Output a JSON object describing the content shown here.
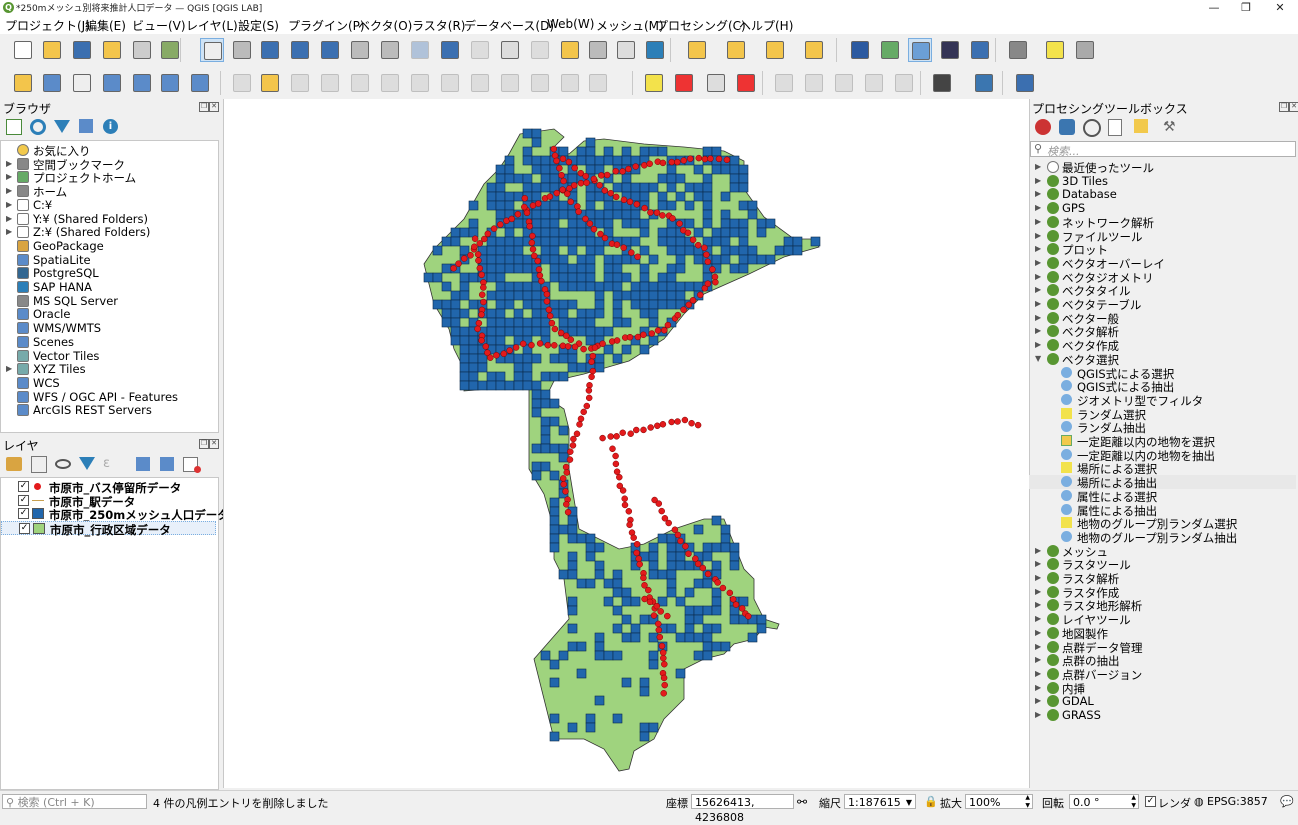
{
  "window": {
    "title": "*250mメッシュ別将来推計人口データ — QGIS [QGIS LAB]",
    "logo": "Q",
    "controls": [
      "—",
      "❐",
      "✕"
    ]
  },
  "menu": [
    "プロジェクト(J)",
    "編集(E)",
    "ビュー(V)",
    "レイヤ(L)",
    "設定(S)",
    "プラグイン(P)",
    "ベクタ(O)",
    "ラスタ(R)",
    "データベース(D)",
    "Web(W)",
    "メッシュ(M)",
    "プロセシング(C)",
    "ヘルプ(H)"
  ],
  "toolbar_row1_icons": [
    "new-project-icon",
    "open-project-icon",
    "save-project-icon",
    "save-as-icon",
    "print-layout-icon",
    "style-manager-icon",
    "pan-hand-icon",
    "pan-to-selection-icon",
    "zoom-in-icon",
    "zoom-out-icon",
    "zoom-full-icon",
    "zoom-to-selection-icon",
    "zoom-to-layer-icon",
    "zoom-native-icon",
    "zoom-last-icon",
    "zoom-next-icon",
    "new-map-view-icon",
    "new-3d-view-icon",
    "bookmark-new-icon",
    "show-bookmarks-icon",
    "temporal-controller-icon",
    "refresh-icon",
    "select-features-icon",
    "attribute-table-select-icon",
    "deselect-icon",
    "select-by-value-icon",
    "identify-icon",
    "field-calculator-icon",
    "processing-toolbox-icon",
    "statistics-sum-icon",
    "attribute-table-icon",
    "measure-icon",
    "map-tips-icon",
    "settings-gear-icon"
  ],
  "toolbar_row2_icons": [
    "add-vector-layer-icon",
    "add-raster-icon",
    "digitize-icon",
    "add-line-icon",
    "add-mesh-icon",
    "add-delimited-icon",
    "add-virtual-icon",
    "edit-pencil-icon",
    "toggle-edit-icon",
    "save-edits-icon",
    "digitize-line-icon",
    "add-feature-icon",
    "vertex-tool-icon",
    "modify-attributes-icon",
    "delete-selected-icon",
    "cut-icon",
    "copy-icon",
    "paste-icon",
    "undo-icon",
    "redo-icon",
    "label-abc-icon",
    "diagram-icon",
    "highlight-label-icon",
    "label-red-icon",
    "pin-label-icon",
    "show-hide-label-icon",
    "move-label-icon",
    "rotate-label-icon",
    "change-label-icon",
    "gps-icon",
    "python-icon",
    "help-icon"
  ],
  "browser": {
    "title": "ブラウザ",
    "items": [
      {
        "label": "お気に入り",
        "icon": "star-icon",
        "arrow": false
      },
      {
        "label": "空間ブックマーク",
        "icon": "bookmark-icon",
        "arrow": true
      },
      {
        "label": "プロジェクトホーム",
        "icon": "project-home-icon",
        "arrow": true
      },
      {
        "label": "ホーム",
        "icon": "home-icon",
        "arrow": true
      },
      {
        "label": "C:¥",
        "icon": "folder-icon",
        "arrow": true
      },
      {
        "label": "Y:¥ (Shared Folders)",
        "icon": "folder-icon",
        "arrow": true
      },
      {
        "label": "Z:¥ (Shared Folders)",
        "icon": "folder-icon",
        "arrow": true
      },
      {
        "label": "GeoPackage",
        "icon": "geopackage-icon",
        "arrow": false
      },
      {
        "label": "SpatiaLite",
        "icon": "spatialite-icon",
        "arrow": false
      },
      {
        "label": "PostgreSQL",
        "icon": "postgresql-icon",
        "arrow": false
      },
      {
        "label": "SAP HANA",
        "icon": "sap-hana-icon",
        "arrow": false
      },
      {
        "label": "MS SQL Server",
        "icon": "mssql-icon",
        "arrow": false
      },
      {
        "label": "Oracle",
        "icon": "oracle-icon",
        "arrow": false
      },
      {
        "label": "WMS/WMTS",
        "icon": "wms-icon",
        "arrow": false
      },
      {
        "label": "Scenes",
        "icon": "scenes-icon",
        "arrow": false
      },
      {
        "label": "Vector Tiles",
        "icon": "vector-tiles-icon",
        "arrow": false
      },
      {
        "label": "XYZ Tiles",
        "icon": "xyz-tiles-icon",
        "arrow": true
      },
      {
        "label": "WCS",
        "icon": "wcs-icon",
        "arrow": false
      },
      {
        "label": "WFS / OGC API - Features",
        "icon": "wfs-icon",
        "arrow": false
      },
      {
        "label": "ArcGIS REST Servers",
        "icon": "arcgis-icon",
        "arrow": false
      }
    ]
  },
  "layers": {
    "title": "レイヤ",
    "items": [
      {
        "label": "市原市_バス停留所データ",
        "symbol": "point",
        "color": "#e31a1c",
        "checked": true
      },
      {
        "label": "市原市_駅データ",
        "symbol": "line",
        "color": "#c8a050",
        "checked": true
      },
      {
        "label": "市原市_250mメッシュ人口データ",
        "symbol": "fill",
        "color": "#2166ac",
        "checked": true
      },
      {
        "label": "市原市_行政区域データ",
        "symbol": "fill",
        "color": "#9fd37e",
        "checked": true
      }
    ]
  },
  "toolbox": {
    "title": "プロセシングツールボックス",
    "search_placeholder": "検索...",
    "groups_top": [
      "最近使ったツール",
      "3D Tiles",
      "Database",
      "GPS",
      "ネットワーク解析",
      "ファイルツール",
      "プロット",
      "ベクタオーバーレイ",
      "ベクタジオメトリ",
      "ベクタタイル",
      "ベクタテーブル",
      "ベクター般",
      "ベクタ解析",
      "ベクタ作成"
    ],
    "open_group": "ベクタ選択",
    "children": [
      "QGIS式による選択",
      "QGIS式による抽出",
      "ジオメトリ型でフィルタ",
      "ランダム選択",
      "ランダム抽出",
      "一定距離以内の地物を選択",
      "一定距離以内の地物を抽出",
      "場所による選択",
      "場所による抽出",
      "属性による選択",
      "属性による抽出",
      "地物のグループ別ランダム選択",
      "地物のグループ別ランダム抽出"
    ],
    "selected_child": "場所による抽出",
    "groups_bottom": [
      "メッシュ",
      "ラスタツール",
      "ラスタ解析",
      "ラスタ作成",
      "ラスタ地形解析",
      "レイヤツール",
      "地図製作",
      "点群データ管理",
      "点群の抽出",
      "点群バージョン",
      "内挿"
    ],
    "providers": [
      "GDAL",
      "GRASS"
    ]
  },
  "status": {
    "search_placeholder": "検索 (Ctrl + K)",
    "message": "4 件の凡例エントリを削除しました",
    "coord_label": "座標",
    "coord_value": "15626413, 4236808",
    "scale_label": "縮尺",
    "scale_value": "1:187615",
    "magnifier_label": "拡大",
    "magnifier_value": "100%",
    "rotation_label": "回転",
    "rotation_value": "0.0 °",
    "render_label": "レンダ",
    "crs": "EPSG:3857"
  },
  "colors": {
    "admin_fill": "#9fd37e",
    "mesh_fill": "#2166ac",
    "bus_stop": "#e31a1c"
  }
}
